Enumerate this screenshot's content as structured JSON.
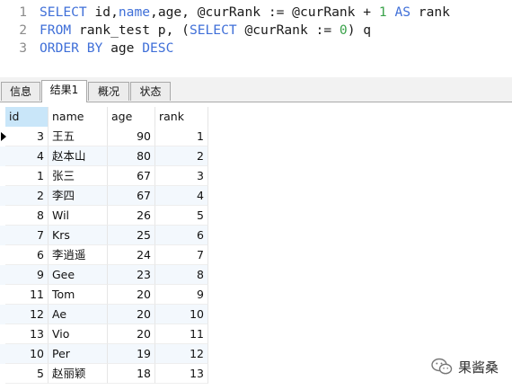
{
  "editor": {
    "lines": [
      {
        "number": "1",
        "tokens": [
          {
            "t": "SELECT",
            "c": "kw"
          },
          {
            "t": " id,",
            "c": "tx"
          },
          {
            "t": "name",
            "c": "kw"
          },
          {
            "t": ",age, @curRank := @curRank + ",
            "c": "tx"
          },
          {
            "t": "1",
            "c": "nm"
          },
          {
            "t": " ",
            "c": "tx"
          },
          {
            "t": "AS",
            "c": "kw"
          },
          {
            "t": " rank",
            "c": "tx"
          }
        ]
      },
      {
        "number": "2",
        "tokens": [
          {
            "t": "FROM",
            "c": "kw"
          },
          {
            "t": " rank_test p, (",
            "c": "tx"
          },
          {
            "t": "SELECT",
            "c": "kw"
          },
          {
            "t": " @curRank := ",
            "c": "tx"
          },
          {
            "t": "0",
            "c": "nm"
          },
          {
            "t": ") q",
            "c": "tx"
          }
        ]
      },
      {
        "number": "3",
        "tokens": [
          {
            "t": "ORDER BY",
            "c": "kw"
          },
          {
            "t": " age ",
            "c": "tx"
          },
          {
            "t": "DESC",
            "c": "kw"
          }
        ]
      }
    ]
  },
  "tabs": [
    {
      "label": "信息",
      "active": false
    },
    {
      "label": "结果1",
      "active": true
    },
    {
      "label": "概况",
      "active": false
    },
    {
      "label": "状态",
      "active": false
    }
  ],
  "grid": {
    "columns": [
      "id",
      "name",
      "age",
      "rank"
    ],
    "rows": [
      [
        "3",
        "王五",
        "90",
        "1"
      ],
      [
        "4",
        "赵本山",
        "80",
        "2"
      ],
      [
        "1",
        "张三",
        "67",
        "3"
      ],
      [
        "2",
        "李四",
        "67",
        "4"
      ],
      [
        "8",
        "Wil",
        "26",
        "5"
      ],
      [
        "7",
        "Krs",
        "25",
        "6"
      ],
      [
        "6",
        "李逍遥",
        "24",
        "7"
      ],
      [
        "9",
        "Gee",
        "23",
        "8"
      ],
      [
        "11",
        "Tom",
        "20",
        "9"
      ],
      [
        "12",
        "Ae",
        "20",
        "10"
      ],
      [
        "13",
        "Vio",
        "20",
        "11"
      ],
      [
        "10",
        "Per",
        "19",
        "12"
      ],
      [
        "5",
        "赵丽颖",
        "18",
        "13"
      ]
    ]
  },
  "watermark": {
    "text": "果酱桑",
    "icon": "wechat-icon"
  }
}
